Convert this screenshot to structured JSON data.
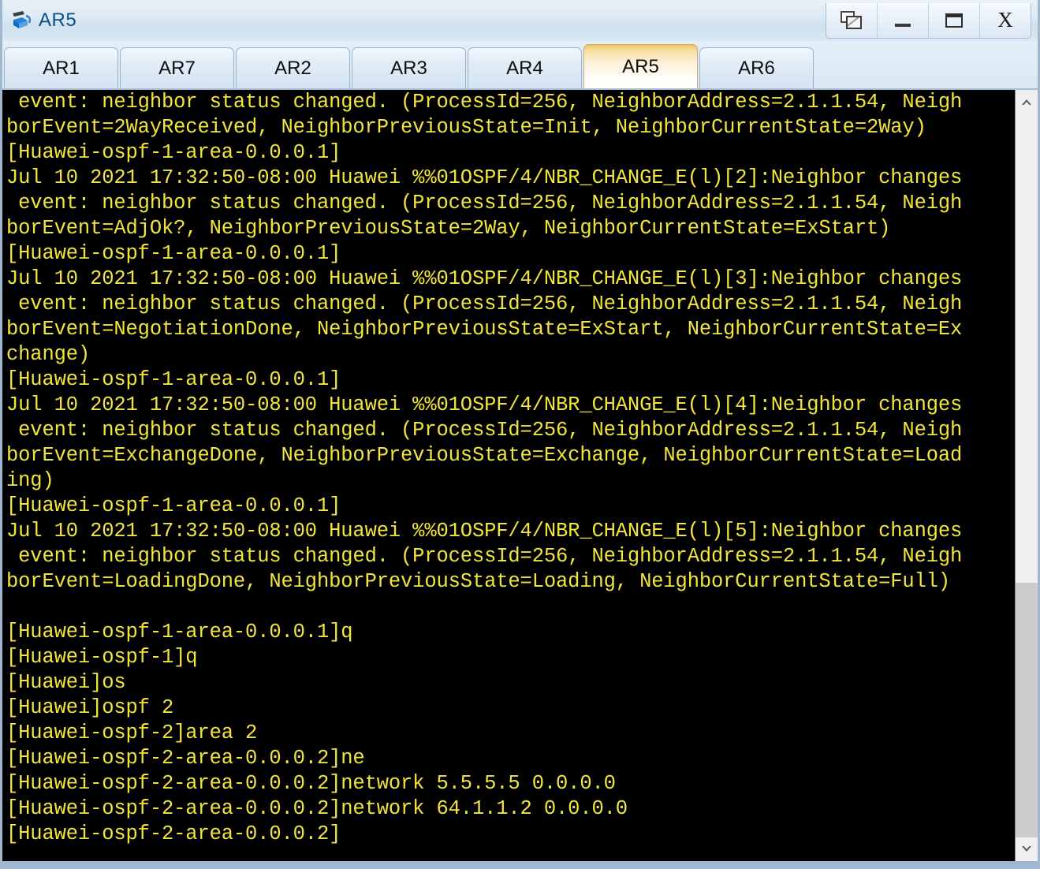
{
  "window": {
    "title": "AR5",
    "icon": "router-device-icon",
    "controls": [
      {
        "name": "restore-down-button",
        "label": "",
        "icon": "restore-window-icon"
      },
      {
        "name": "minimize-button",
        "label": "",
        "icon": "minimize-icon"
      },
      {
        "name": "maximize-button",
        "label": "",
        "icon": "maximize-icon"
      },
      {
        "name": "close-button",
        "label": "X",
        "icon": "close-icon"
      }
    ]
  },
  "tabs": [
    {
      "label": "AR1",
      "active": false
    },
    {
      "label": "AR7",
      "active": false
    },
    {
      "label": "AR2",
      "active": false
    },
    {
      "label": "AR3",
      "active": false
    },
    {
      "label": "AR4",
      "active": false
    },
    {
      "label": "AR5",
      "active": true
    },
    {
      "label": "AR6",
      "active": false
    }
  ],
  "terminal": {
    "foreground": "#f2e63c",
    "background": "#000000",
    "lines": [
      " event: neighbor status changed. (ProcessId=256, NeighborAddress=2.1.1.54, Neigh",
      "borEvent=2WayReceived, NeighborPreviousState=Init, NeighborCurrentState=2Way)",
      "[Huawei-ospf-1-area-0.0.0.1]",
      "Jul 10 2021 17:32:50-08:00 Huawei %%01OSPF/4/NBR_CHANGE_E(l)[2]:Neighbor changes",
      " event: neighbor status changed. (ProcessId=256, NeighborAddress=2.1.1.54, Neigh",
      "borEvent=AdjOk?, NeighborPreviousState=2Way, NeighborCurrentState=ExStart)",
      "[Huawei-ospf-1-area-0.0.0.1]",
      "Jul 10 2021 17:32:50-08:00 Huawei %%01OSPF/4/NBR_CHANGE_E(l)[3]:Neighbor changes",
      " event: neighbor status changed. (ProcessId=256, NeighborAddress=2.1.1.54, Neigh",
      "borEvent=NegotiationDone, NeighborPreviousState=ExStart, NeighborCurrentState=Ex",
      "change)",
      "[Huawei-ospf-1-area-0.0.0.1]",
      "Jul 10 2021 17:32:50-08:00 Huawei %%01OSPF/4/NBR_CHANGE_E(l)[4]:Neighbor changes",
      " event: neighbor status changed. (ProcessId=256, NeighborAddress=2.1.1.54, Neigh",
      "borEvent=ExchangeDone, NeighborPreviousState=Exchange, NeighborCurrentState=Load",
      "ing)",
      "[Huawei-ospf-1-area-0.0.0.1]",
      "Jul 10 2021 17:32:50-08:00 Huawei %%01OSPF/4/NBR_CHANGE_E(l)[5]:Neighbor changes",
      " event: neighbor status changed. (ProcessId=256, NeighborAddress=2.1.1.54, Neigh",
      "borEvent=LoadingDone, NeighborPreviousState=Loading, NeighborCurrentState=Full)",
      "",
      "[Huawei-ospf-1-area-0.0.0.1]q",
      "[Huawei-ospf-1]q",
      "[Huawei]os",
      "[Huawei]ospf 2",
      "[Huawei-ospf-2]area 2",
      "[Huawei-ospf-2-area-0.0.0.2]ne",
      "[Huawei-ospf-2-area-0.0.0.2]network 5.5.5.5 0.0.0.0",
      "[Huawei-ospf-2-area-0.0.0.2]network 64.1.1.2 0.0.0.0",
      "[Huawei-ospf-2-area-0.0.0.2]"
    ]
  },
  "scrollbar": {
    "up_arrow": "chevron-up-icon",
    "down_arrow": "chevron-down-icon",
    "thumb_name": "scrollbar-thumb"
  }
}
